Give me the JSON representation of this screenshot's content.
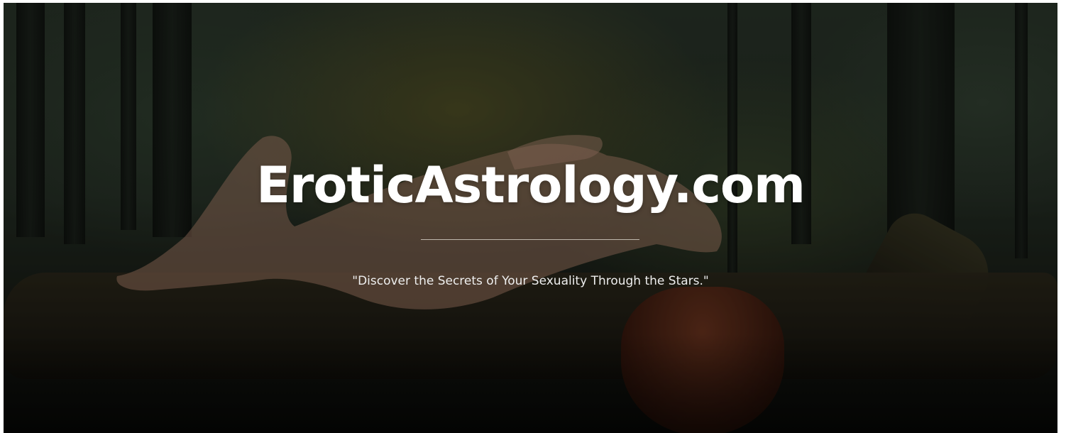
{
  "hero": {
    "title": "EroticAstrology.com",
    "tagline": "\"Discover the Secrets of Your Sexuality Through the Stars.\""
  },
  "colors": {
    "title_text": "#ffffff",
    "tagline_text": "#eeeeee",
    "divider": "#e6e1d7",
    "page_background": "#ffffff"
  }
}
